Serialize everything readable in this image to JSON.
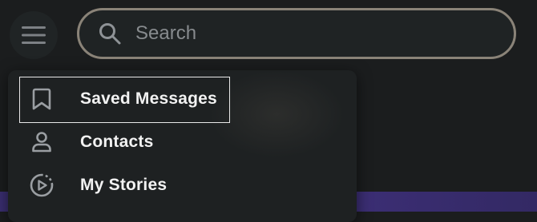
{
  "search": {
    "placeholder": "Search",
    "value": ""
  },
  "menu": {
    "items": [
      {
        "label": "Saved Messages",
        "icon": "bookmark-icon"
      },
      {
        "label": "Contacts",
        "icon": "person-icon"
      },
      {
        "label": "My Stories",
        "icon": "stories-icon"
      }
    ]
  },
  "colors": {
    "background": "#1b1d1e",
    "search_border": "#8a8378",
    "menu_bg": "#1e2122",
    "text": "#f2f2f2",
    "accent_strip": "#3d2f77"
  }
}
